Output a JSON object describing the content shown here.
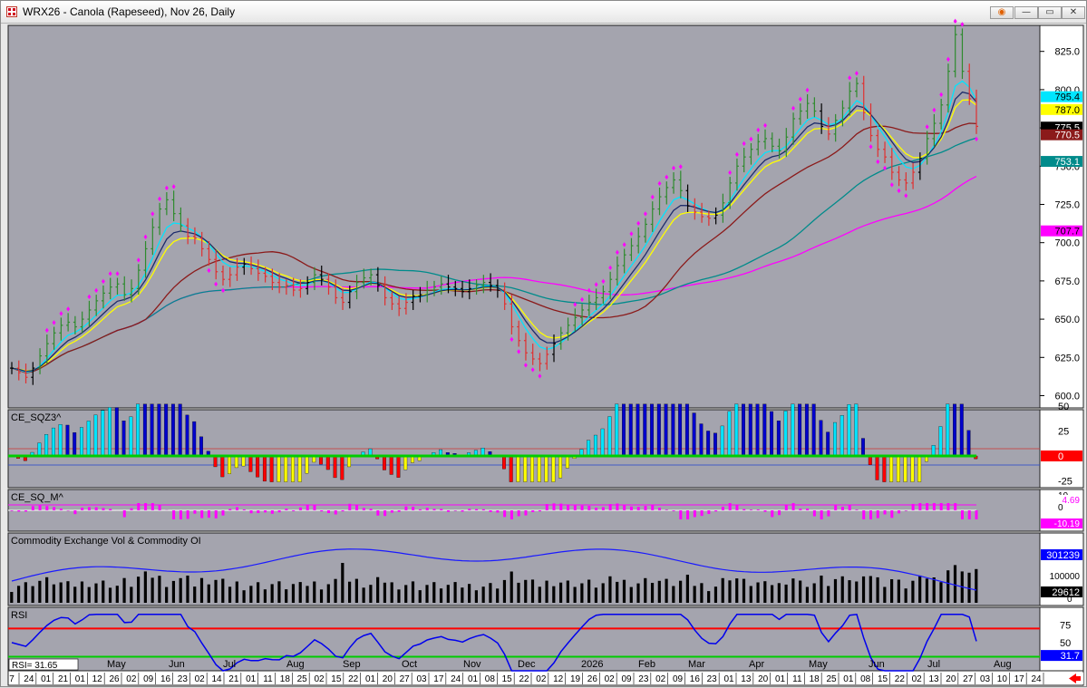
{
  "window": {
    "title": "WRX26 - Canola (Rapeseed), Nov 26, Daily",
    "buttons": {
      "record": "◉",
      "minimize": "—",
      "restore": "▭",
      "close": "✕"
    }
  },
  "chart_data": {
    "type": "line",
    "symbol": "WRX26",
    "price_panel": {
      "yaxis_ticks": [
        600,
        625,
        650,
        675,
        700,
        725,
        750,
        775,
        800,
        825
      ],
      "ylim": [
        592,
        842
      ],
      "close_series": [
        618,
        615,
        612,
        618,
        626,
        634,
        641,
        646,
        648,
        645,
        650,
        656,
        662,
        667,
        671,
        673,
        666,
        670,
        682,
        696,
        710,
        722,
        728,
        719,
        711,
        704,
        703,
        696,
        689,
        681,
        676,
        679,
        684,
        686,
        683,
        680,
        678,
        674,
        671,
        672,
        669,
        670,
        674,
        679,
        676,
        671,
        664,
        661,
        668,
        674,
        677,
        679,
        672,
        664,
        660,
        657,
        661,
        665,
        666,
        669,
        671,
        673,
        671,
        670,
        668,
        670,
        672,
        674,
        672,
        669,
        660,
        645,
        636,
        628,
        624,
        621,
        627,
        634,
        641,
        646,
        651,
        656,
        661,
        664,
        668,
        676,
        685,
        692,
        698,
        704,
        712,
        722,
        730,
        736,
        741,
        734,
        724,
        720,
        717,
        716,
        718,
        726,
        739,
        750,
        756,
        761,
        766,
        768,
        763,
        760,
        769,
        781,
        786,
        791,
        786,
        776,
        771,
        780,
        788,
        799,
        804,
        785,
        770,
        761,
        756,
        746,
        741,
        739,
        746,
        755,
        768,
        778,
        790,
        812,
        836,
        812,
        794,
        776
      ],
      "price_labels": [
        {
          "value": "795.4",
          "color": "#00e5ff",
          "text_color": "#000000"
        },
        {
          "value": "787.0",
          "color": "#ffff00",
          "text_color": "#000000"
        },
        {
          "value": "775.5",
          "color": "#000000",
          "text_color": "#ffffff"
        },
        {
          "value": "770.5",
          "color": "#8b1a1a",
          "text_color": "#ffffff"
        },
        {
          "value": "753.1",
          "color": "#008b8b",
          "text_color": "#ffffff"
        },
        {
          "value": "707.7",
          "color": "#ff00ff",
          "text_color": "#000000"
        }
      ],
      "ma_colors": {
        "fast": "#00e5ff",
        "mid": "#ffff00",
        "slow": "#8b1a1a",
        "slower": "#008b8b",
        "slowest": "#ff00ff"
      }
    },
    "squeeze_panel": {
      "title": "CE_SQZ3^",
      "yaxis_ticks": [
        "50",
        "25",
        "0",
        "-25"
      ],
      "last_label": {
        "value": "0",
        "color": "#ff0000"
      }
    },
    "sqm_panel": {
      "title": "CE_SQ_M^",
      "yaxis_ticks": [
        "10",
        "0"
      ],
      "labels": [
        {
          "value": "4.69",
          "color": "#ff00ff"
        },
        {
          "value": "-10.19",
          "color": "#ff00ff"
        }
      ]
    },
    "volume_panel": {
      "title": "Commodity Exchange Vol & Commodity OI",
      "yaxis_ticks": [
        "100000",
        "0"
      ],
      "labels": [
        {
          "value": "301239",
          "color": "#0000ff",
          "text_color": "#ffffff"
        },
        {
          "value": "29612",
          "color": "#000000",
          "text_color": "#ffffff"
        }
      ]
    },
    "rsi_panel": {
      "title": "RSI",
      "yaxis_ticks": [
        "75",
        "50"
      ],
      "upper_line": 70,
      "lower_line": 30,
      "last_label": {
        "value": "31.7",
        "color": "#0000ff"
      },
      "readout": "RSI=     31.65"
    },
    "xaxis": {
      "months": [
        {
          "label": "May",
          "x": 117
        },
        {
          "label": "Jun",
          "x": 185
        },
        {
          "label": "Jul",
          "x": 245
        },
        {
          "label": "Aug",
          "x": 315
        },
        {
          "label": "Sep",
          "x": 377
        },
        {
          "label": "Oct",
          "x": 442
        },
        {
          "label": "Nov",
          "x": 510
        },
        {
          "label": "Dec",
          "x": 570
        },
        {
          "label": "2026",
          "x": 640
        },
        {
          "label": "Feb",
          "x": 703
        },
        {
          "label": "Mar",
          "x": 758
        },
        {
          "label": "Apr",
          "x": 825
        },
        {
          "label": "May",
          "x": 891
        },
        {
          "label": "Jun",
          "x": 957
        },
        {
          "label": "Jul",
          "x": 1022
        },
        {
          "label": "Aug",
          "x": 1095
        }
      ],
      "days": [
        "7",
        "24",
        "01",
        "21",
        "01",
        "12",
        "26",
        "02",
        "09",
        "16",
        "23",
        "02",
        "14",
        "21",
        "01",
        "11",
        "18",
        "25",
        "02",
        "15",
        "22",
        "01",
        "20",
        "27",
        "03",
        "17",
        "24",
        "01",
        "08",
        "15",
        "22",
        "02",
        "12",
        "19",
        "26",
        "02",
        "09",
        "23",
        "02",
        "09",
        "16",
        "23",
        "01",
        "13",
        "20",
        "01",
        "11",
        "18",
        "25",
        "01",
        "08",
        "15",
        "22",
        "02",
        "13",
        "20",
        "27",
        "03",
        "10",
        "17",
        "24"
      ]
    }
  }
}
